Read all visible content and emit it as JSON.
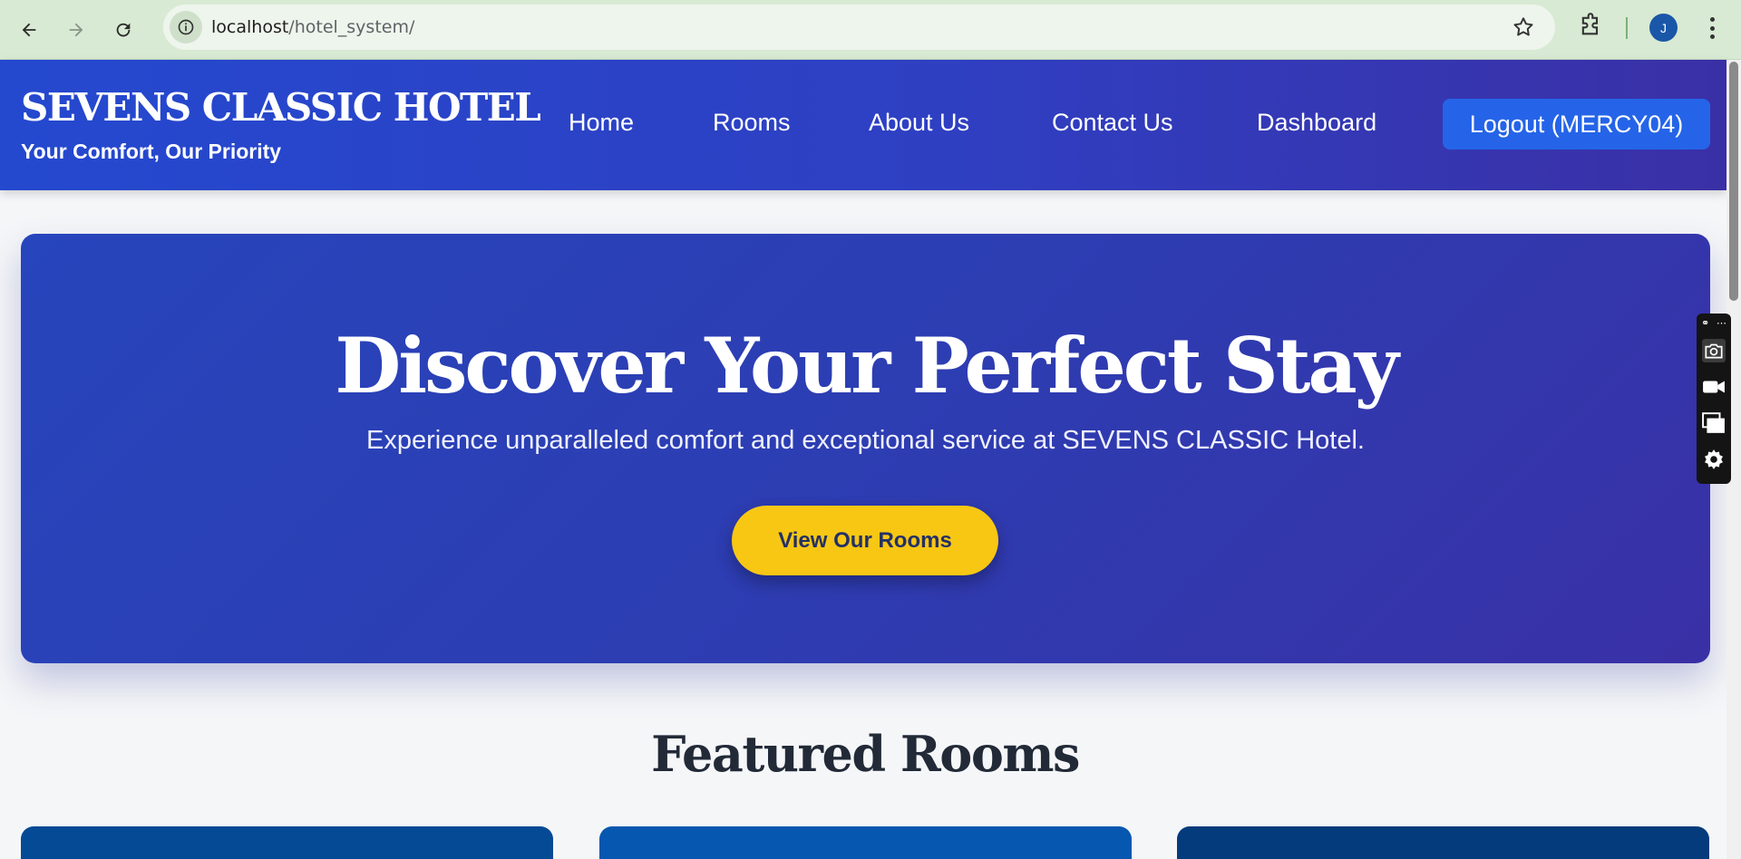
{
  "browser": {
    "url_host": "localhost",
    "url_path": "/hotel_system/",
    "profile_initial": "J"
  },
  "header": {
    "brand_title": "SEVENS CLASSIC HOTEL",
    "brand_tagline": "Your Comfort, Our Priority",
    "nav": [
      {
        "label": "Home"
      },
      {
        "label": "Rooms"
      },
      {
        "label": "About Us"
      },
      {
        "label": "Contact Us"
      },
      {
        "label": "Dashboard"
      }
    ],
    "logout_label": "Logout (MERCY04)"
  },
  "hero": {
    "title": "Discover Your Perfect Stay",
    "subtitle": "Experience unparalleled comfort and exceptional service at SEVENS CLASSIC Hotel.",
    "cta_label": "View Our Rooms"
  },
  "featured": {
    "title": "Featured Rooms"
  },
  "colors": {
    "header_start": "#2449cf",
    "header_end": "#3a30a6",
    "cta": "#f7c714",
    "logout": "#2564e8",
    "card_colors": [
      "#054a94",
      "#0557b0",
      "#043b7c"
    ]
  },
  "icons": [
    "back-arrow-icon",
    "forward-arrow-icon",
    "reload-icon",
    "info-icon",
    "star-icon",
    "extensions-icon",
    "camera-icon",
    "video-icon",
    "windows-icon",
    "gear-icon"
  ]
}
